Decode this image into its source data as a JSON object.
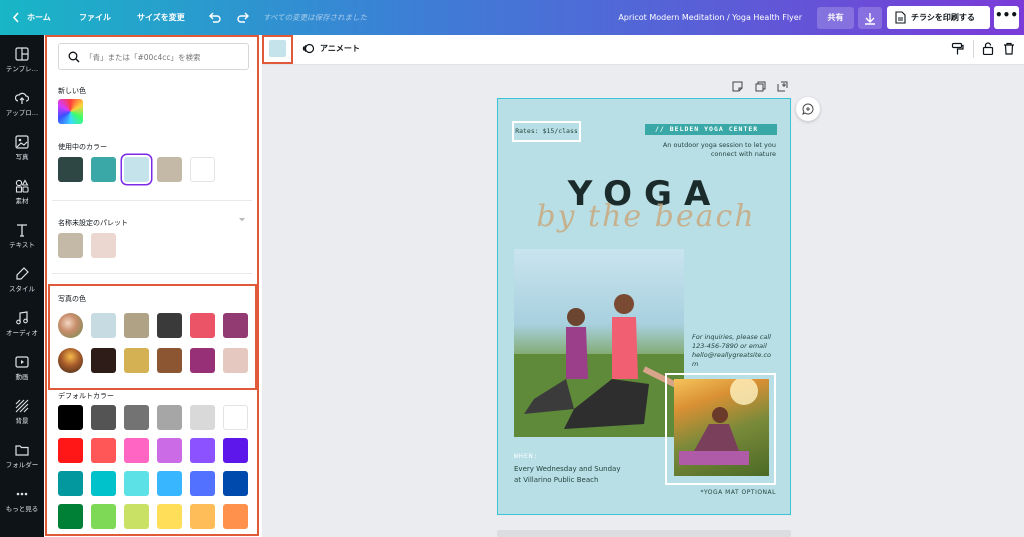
{
  "topbar": {
    "home_label": "ホーム",
    "file_label": "ファイル",
    "resize_label": "サイズを変更",
    "saved_status": "すべての変更は保存されました",
    "doc_title": "Apricot Modern Meditation / Yoga Health Flyer",
    "share_label": "共有",
    "print_label": "チラシを印刷する",
    "more_label": "•••"
  },
  "sidebar": {
    "items": [
      {
        "label": "テンプレ…",
        "icon": "template-icon"
      },
      {
        "label": "アップロ…",
        "icon": "upload-icon"
      },
      {
        "label": "写真",
        "icon": "photo-icon"
      },
      {
        "label": "素材",
        "icon": "elements-icon"
      },
      {
        "label": "テキスト",
        "icon": "text-icon"
      },
      {
        "label": "スタイル",
        "icon": "style-icon"
      },
      {
        "label": "オーディオ",
        "icon": "audio-icon"
      },
      {
        "label": "動画",
        "icon": "video-icon"
      },
      {
        "label": "背景",
        "icon": "background-icon"
      },
      {
        "label": "フォルダー",
        "icon": "folder-icon"
      },
      {
        "label": "もっと見る",
        "icon": "more-icon"
      }
    ]
  },
  "color_panel": {
    "search_placeholder": "「青」または「#00c4cc」を検索",
    "new_color_label": "新しい色",
    "in_use_label": "使用中のカラー",
    "in_use_colors": [
      "#2e4744",
      "#39a8a7",
      "#c5e3ea",
      "#c4b8a7",
      "#ffffff"
    ],
    "palette_label": "名称未設定のパレット",
    "palette_colors": [
      "#c4b8a7",
      "#ecd6d0"
    ],
    "photo_colors_label": "写真の色",
    "photo_row1": [
      "#c7dbe3",
      "#b0a284",
      "#3a3a3a",
      "#ea5466",
      "#923b73"
    ],
    "photo_row2": [
      "#2d1c17",
      "#d4b153",
      "#8d5632",
      "#983078",
      "#e5c9c0"
    ],
    "default_label": "デフォルトカラー",
    "default_rows": [
      [
        "#000000",
        "#545454",
        "#737373",
        "#a6a6a6",
        "#d9d9d9",
        "#ffffff"
      ],
      [
        "#ff1616",
        "#ff5757",
        "#ff66c4",
        "#cb6ce6",
        "#8c52ff",
        "#5e17eb"
      ],
      [
        "#03989e",
        "#00c2cb",
        "#5ce1e6",
        "#38b6ff",
        "#5271ff",
        "#004aad"
      ],
      [
        "#008037",
        "#7ed957",
        "#c9e265",
        "#ffde59",
        "#ffbd59",
        "#ff914d"
      ]
    ]
  },
  "context_toolbar": {
    "selected_color": "#c5e3ea",
    "animate_label": "アニメート"
  },
  "flyer": {
    "rates": "Rates: $15/class",
    "center": "//  BELDEN YOGA CENTER",
    "tagline": "An outdoor yoga session to let you connect with nature",
    "title": "YOGA",
    "script": "by the beach",
    "inquiry_line1": "For inquiries, please call",
    "inquiry_line2": "123-456-7890 or email",
    "inquiry_line3": "hello@reallygreatsite.co",
    "inquiry_line4": "m",
    "when_label": "WHEN:",
    "when_line1": "Every Wednesday and Sunday",
    "when_line2": "at Villarino Public Beach",
    "mat": "*YOGA MAT OPTIONAL"
  }
}
